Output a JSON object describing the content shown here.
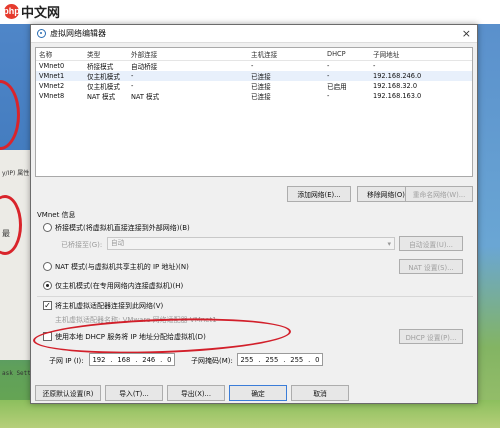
{
  "site": {
    "logo_mark": "php",
    "logo_text": "中文网"
  },
  "side": {
    "frag1": "y/IP) 属性",
    "frag2": "最",
    "frag3": "ask Sett"
  },
  "dialog": {
    "title": "虚拟网络编辑器",
    "close": "×",
    "table": {
      "headers": [
        "名称",
        "类型",
        "外部连接",
        "主机连接",
        "DHCP",
        "子网地址"
      ],
      "rows": [
        [
          "VMnet0",
          "桥接模式",
          "自动桥接",
          "-",
          "-",
          "-"
        ],
        [
          "VMnet1",
          "仅主机模式",
          "-",
          "已连接",
          "-",
          "192.168.246.0"
        ],
        [
          "VMnet2",
          "仅主机模式",
          "-",
          "已连接",
          "已启用",
          "192.168.32.0"
        ],
        [
          "VMnet8",
          "NAT 模式",
          "NAT 模式",
          "已连接",
          "-",
          "192.168.163.0"
        ]
      ]
    },
    "buttons": {
      "add": "添加网络(E)...",
      "remove": "移除网络(O)",
      "rename": "重命名网络(W)...",
      "auto": "自动设置(U)...",
      "nat": "NAT 设置(S)...",
      "dhcp": "DHCP 设置(P)...",
      "restore": "还原默认设置(R)",
      "import": "导入(T)...",
      "export": "导出(X)...",
      "ok": "确定",
      "cancel": "取消"
    },
    "info_title": "VMnet 信息",
    "bridge_mode": "桥接模式(将虚拟机直接连接到外部网络)(B)",
    "bridge_to": "已桥接至(G):",
    "bridge_value": "自动",
    "nat_mode": "NAT 模式(与虚拟机共享主机的 IP 地址)(N)",
    "host_only": "仅主机模式(在专用网络内连接虚拟机)(H)",
    "connect_adapter": "将主机虚拟适配器连接到此网络(V)",
    "adapter_name": "主机虚拟适配器名称: VMware 网络适配器 VMnet1",
    "use_dhcp": "使用本地 DHCP 服务将 IP 地址分配给虚拟机(D)",
    "subnet_ip_label": "子网 IP (I):",
    "subnet_ip": [
      "192",
      "168",
      "246",
      "0"
    ],
    "subnet_mask_label": "子网掩码(M):",
    "subnet_mask": [
      "255",
      "255",
      "255",
      "0"
    ]
  }
}
